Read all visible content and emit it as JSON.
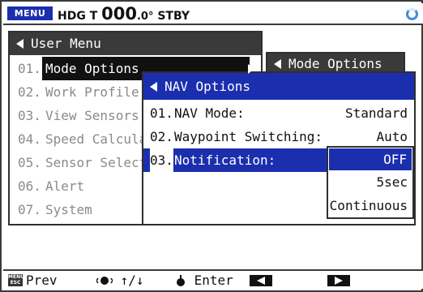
{
  "status": {
    "menu_badge": "MENU",
    "hdg_prefix": "HDG T",
    "hdg_value": "000",
    "hdg_decimal": ".0°",
    "mode": "STBY"
  },
  "user_menu": {
    "title": "User Menu",
    "items": [
      {
        "num": "01.",
        "label": "Mode Options"
      },
      {
        "num": "02.",
        "label": "Work Profile"
      },
      {
        "num": "03.",
        "label": "View Sensors"
      },
      {
        "num": "04.",
        "label": "Speed Calcula"
      },
      {
        "num": "05.",
        "label": "Sensor Select"
      },
      {
        "num": "06.",
        "label": "Alert"
      },
      {
        "num": "07.",
        "label": "System"
      }
    ]
  },
  "mode_options": {
    "title": "Mode Options"
  },
  "nav_options": {
    "title": "NAV Options",
    "rows": [
      {
        "num": "01.",
        "label": "NAV Mode:",
        "value": "Standard"
      },
      {
        "num": "02.",
        "label": "Waypoint Switching:",
        "value": "Auto"
      },
      {
        "num": "03.",
        "label": "Notification:",
        "value": ""
      }
    ]
  },
  "notification_options": {
    "options": [
      "OFF",
      "5sec",
      "Continuous"
    ],
    "selected": "OFF"
  },
  "footer": {
    "menu_icon_text": "MENU ESC",
    "prev_label": "Prev",
    "updown_label": "↑/↓",
    "enter_label": "Enter"
  },
  "colors": {
    "accent": "#1b2fae",
    "title_bar": "#3a3a3a",
    "disabled_text": "#8a8a8a"
  }
}
